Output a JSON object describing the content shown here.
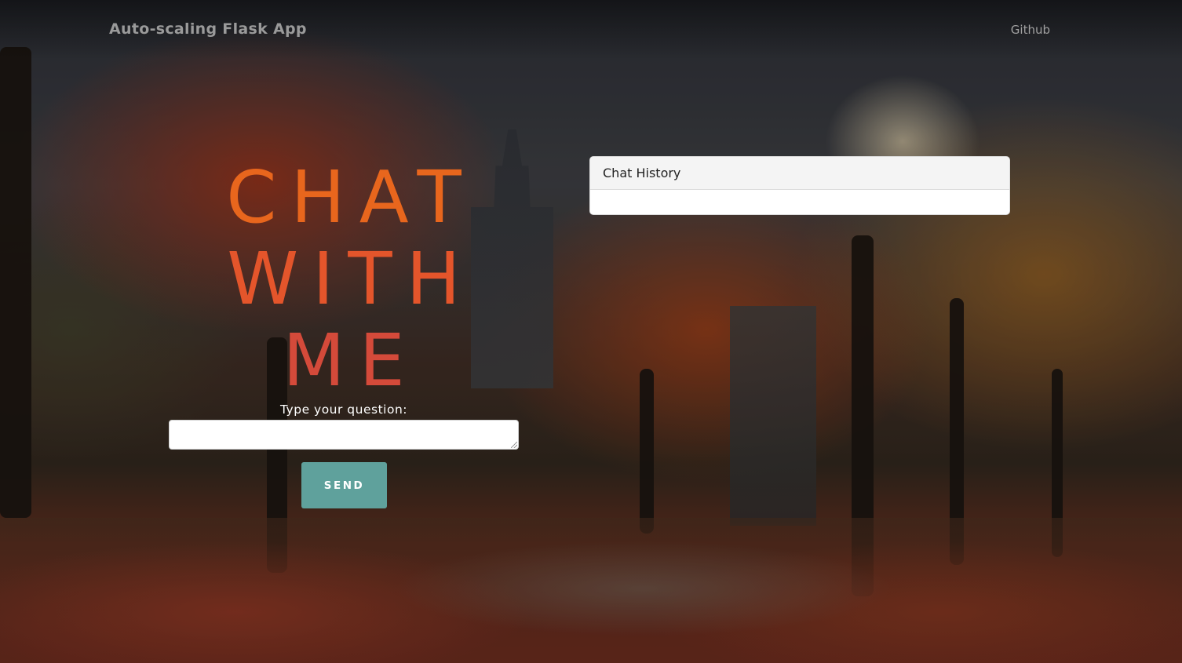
{
  "navbar": {
    "brand": "Auto-scaling Flask App",
    "link": "Github"
  },
  "hero": {
    "lines": [
      "CHAT",
      "WITH",
      "ME"
    ],
    "colors": [
      "#e8661d",
      "#e4552b",
      "#d44a3a"
    ]
  },
  "form": {
    "label": "Type your question:",
    "input_value": "",
    "submit_label": "SEND",
    "accent": "#5fa19c"
  },
  "chat_history": {
    "title": "Chat History",
    "messages": []
  }
}
